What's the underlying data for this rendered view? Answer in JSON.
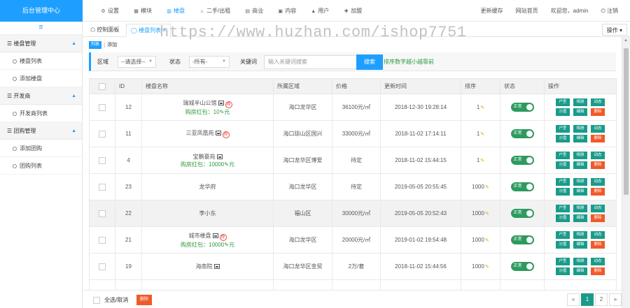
{
  "app": {
    "brand": "后台管理中心"
  },
  "topnav": [
    {
      "icon": "gear-icon",
      "glyph": "⚙",
      "label": "设置"
    },
    {
      "icon": "module-icon",
      "glyph": "▦",
      "label": "模块"
    },
    {
      "icon": "building-icon",
      "glyph": "▥",
      "label": "楼盘"
    },
    {
      "icon": "house-icon",
      "glyph": "⌂",
      "label": "二手/出租"
    },
    {
      "icon": "shop-icon",
      "glyph": "▤",
      "label": "商业"
    },
    {
      "icon": "content-icon",
      "glyph": "▣",
      "label": "内容"
    },
    {
      "icon": "user-icon",
      "glyph": "▲",
      "label": "用户"
    },
    {
      "icon": "join-icon",
      "glyph": "✚",
      "label": "加盟"
    }
  ],
  "topright": {
    "refresh": "更新缓存",
    "home": "网站首页",
    "welcome": "欢迎您，admin",
    "logout": "⏻ 注销"
  },
  "sidebar": {
    "toggle": "≡",
    "groups": [
      {
        "label": "☰ 楼盘管理",
        "items": [
          "楼盘列表",
          "添加楼盘"
        ]
      },
      {
        "label": "☰ 开发商",
        "items": [
          "开发商列表"
        ]
      },
      {
        "label": "☰ 团购管理",
        "items": [
          "添加团购",
          "团购列表"
        ]
      }
    ]
  },
  "tabs": {
    "dashboard": "☖ 控制面板",
    "current": "◯ 楼盘列表",
    "close": "×",
    "action": "操作 ▾"
  },
  "watermark": "https://www.huzhan.com/ishop7751",
  "subbar": {
    "list": "列表",
    "sep": "|",
    "add": "添加"
  },
  "filter": {
    "region_label": "区域",
    "region_value": "--请选择--",
    "status_label": "状态",
    "status_value": "-所有-",
    "keyword_label": "关键词",
    "keyword_placeholder": "输入关键词搜索",
    "search": "搜索",
    "hint": "排序数字越小越靠前"
  },
  "table": {
    "headers": [
      "",
      "ID",
      "楼盘名称",
      "所属区域",
      "价格",
      "更新时间",
      "排序",
      "状态",
      "操作"
    ],
    "rows": [
      {
        "id": "12",
        "name": "瑞城半山公馆",
        "pic": true,
        "rec": true,
        "bonus": "购房红包：10✎元",
        "region": "海口龙华区",
        "price": "36100元/㎡",
        "time": "2018-12-30 19:28:14",
        "sort": "1",
        "status": "正常",
        "hl": false
      },
      {
        "id": "11",
        "name": "三亚凤凰苑",
        "pic": true,
        "rec": true,
        "bonus": "",
        "region": "海口琼山区国兴",
        "price": "33000元/㎡",
        "time": "2018-11-02 17:14:11",
        "sort": "1",
        "status": "正常",
        "hl": false
      },
      {
        "id": "4",
        "name": "宝鹏豪苑",
        "pic": true,
        "rec": false,
        "bonus": "购房红包：10000✎元",
        "region": "海口龙华区博爱",
        "price": "待定",
        "time": "2018-11-02 15:44:15",
        "sort": "1",
        "status": "正常",
        "hl": false
      },
      {
        "id": "23",
        "name": "龙华府",
        "pic": false,
        "rec": false,
        "bonus": "",
        "region": "海口龙华区",
        "price": "待定",
        "time": "2019-05-05 20:55:45",
        "sort": "1000",
        "status": "正常",
        "hl": false
      },
      {
        "id": "22",
        "name": "李小东",
        "pic": false,
        "rec": false,
        "bonus": "",
        "region": "福山区",
        "price": "30000元/㎡",
        "time": "2019-05-05 20:52:43",
        "sort": "1000",
        "status": "正常",
        "hl": true
      },
      {
        "id": "21",
        "name": "城市楼盘",
        "pic": true,
        "rec": true,
        "bonus": "购房红包：10000✎元",
        "region": "海口龙华区",
        "price": "20000元/㎡",
        "time": "2019-01-02 19:54:48",
        "sort": "1000",
        "status": "正常",
        "hl": false
      },
      {
        "id": "19",
        "name": "海南院",
        "pic": true,
        "rec": false,
        "bonus": "",
        "region": "海口龙华区金贸",
        "price": "2万/套",
        "time": "2018-11-02 15:44:56",
        "sort": "1000",
        "status": "正常",
        "hl": false
      }
    ],
    "ops": [
      "户型",
      "相册",
      "动态",
      "沙盘",
      "编辑",
      "删除"
    ]
  },
  "footer": {
    "select_all": "全选/取消",
    "delete": "删除",
    "pages": [
      "«",
      "1",
      "2",
      "»"
    ],
    "current_page": "1"
  },
  "colors": {
    "accent": "#1e9fff",
    "teal": "#1a9b8a",
    "danger": "#f05a28",
    "green": "#2e9a3e"
  }
}
